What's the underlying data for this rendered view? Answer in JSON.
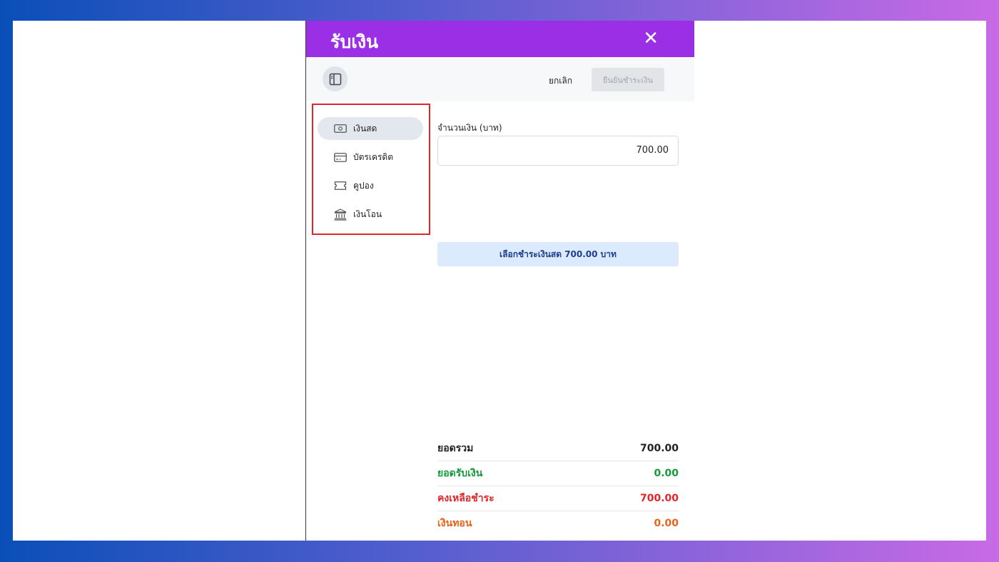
{
  "dialog": {
    "title": "รับเงิน",
    "close_symbol": "✕"
  },
  "toolbar": {
    "cancel_label": "ยกเลิก",
    "confirm_label": "ยืนยันชำระเงิน"
  },
  "methods": [
    {
      "label": "เงินสด",
      "icon": "banknote-icon",
      "active": true
    },
    {
      "label": "บัตรเครดิต",
      "icon": "credit-card-icon",
      "active": false
    },
    {
      "label": "คูปอง",
      "icon": "coupon-icon",
      "active": false
    },
    {
      "label": "เงินโอน",
      "icon": "bank-icon",
      "active": false
    }
  ],
  "payment": {
    "amount_label": "จำนวนเงิน (บาท)",
    "amount_value": "700.00",
    "select_button_label": "เลือกชำระเงินสด 700.00 บาท"
  },
  "summary": {
    "total_label": "ยอดรวม",
    "total_value": "700.00",
    "received_label": "ยอดรับเงิน",
    "received_value": "0.00",
    "remaining_label": "คงเหลือชำระ",
    "remaining_value": "700.00",
    "change_label": "เงินทอน",
    "change_value": "0.00"
  },
  "colors": {
    "header": "#9b2fe6",
    "highlight_border": "#e0262a",
    "received": "#159a3a",
    "remaining": "#e0262a",
    "change": "#e8621a"
  }
}
